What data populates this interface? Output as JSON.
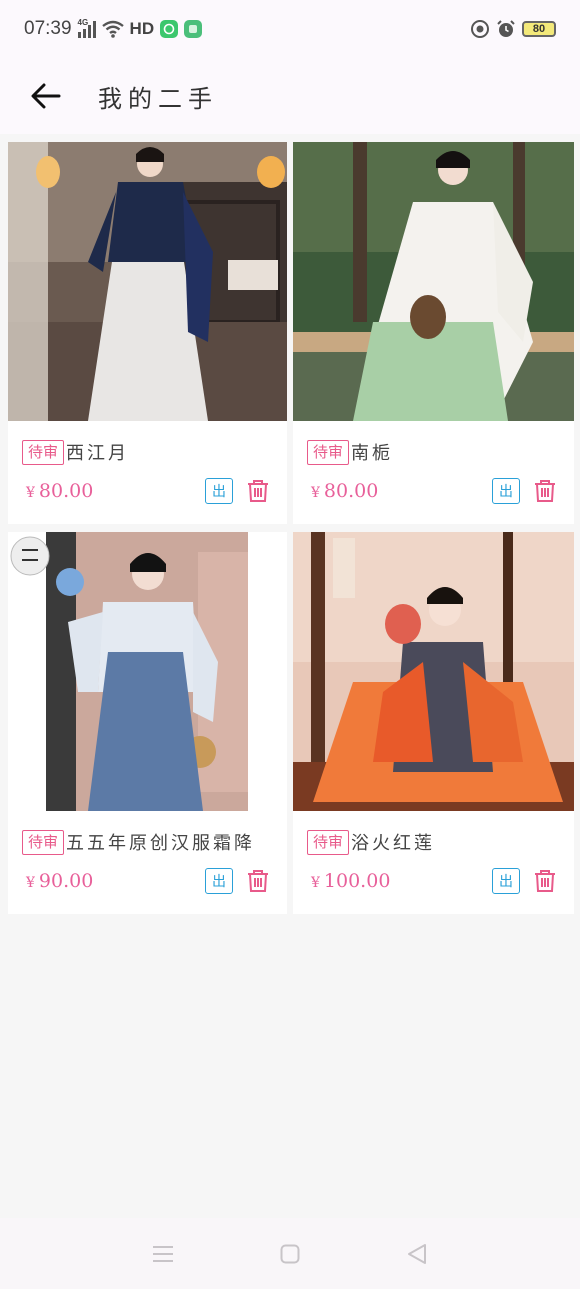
{
  "status_bar": {
    "time": "07:39",
    "network": "4G",
    "hd": "HD",
    "battery": "80"
  },
  "header": {
    "title": "我的二手"
  },
  "items": [
    {
      "tag": "待审",
      "name": "西江月",
      "currency": "¥",
      "price": "80.00",
      "out_label": "出"
    },
    {
      "tag": "待审",
      "name": "南栀",
      "currency": "¥",
      "price": "80.00",
      "out_label": "出"
    },
    {
      "tag": "待审",
      "name": "五五年原创汉服霜降",
      "currency": "¥",
      "price": "90.00",
      "out_label": "出"
    },
    {
      "tag": "待审",
      "name": "浴火红莲",
      "currency": "¥",
      "price": "100.00",
      "out_label": "出"
    }
  ],
  "colors": {
    "accent_pink": "#e85a8a",
    "accent_blue": "#2aa0d8"
  }
}
